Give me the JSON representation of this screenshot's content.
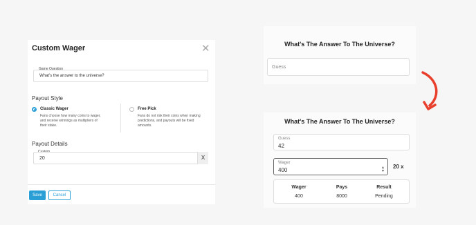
{
  "modal": {
    "title": "Custom Wager",
    "game_question_label": "Game Question",
    "game_question_value": "What's the answer to the universe?",
    "payout_style_label": "Payout Style",
    "options": [
      {
        "title": "Classic Wager",
        "desc_lines": [
          "Fans choose how many coins to wager,",
          "and receive winnings as multipliers of",
          "their stake."
        ],
        "selected": true
      },
      {
        "title": "Free Pick",
        "desc_lines": [
          "Fans do not risk their coins when making",
          "predictions, and payouts will be fixed",
          "amounts."
        ],
        "selected": false
      }
    ],
    "payout_details_label": "Payout Details",
    "custom_label": "Custom",
    "custom_value": "20",
    "clear_label": "X",
    "save_label": "Save",
    "cancel_label": "Cancel"
  },
  "panel_top": {
    "title": "What's The Answer To The Universe?",
    "guess_placeholder": "Guess"
  },
  "panel_bottom": {
    "title": "What's The Answer To The Universe?",
    "guess_label": "Guess",
    "guess_value": "42",
    "wager_label": "Wager",
    "wager_value": "400",
    "multiplier": "20 x",
    "table": {
      "headers": [
        "Wager",
        "Pays",
        "Result"
      ],
      "values": [
        "400",
        "8000",
        "Pending"
      ]
    }
  },
  "colors": {
    "accent": "#2a9fd6",
    "arrow": "#e8402c"
  },
  "icons": {
    "close": "close-icon",
    "arrow": "curved-arrow-icon",
    "spinner": "stepper-icon"
  }
}
